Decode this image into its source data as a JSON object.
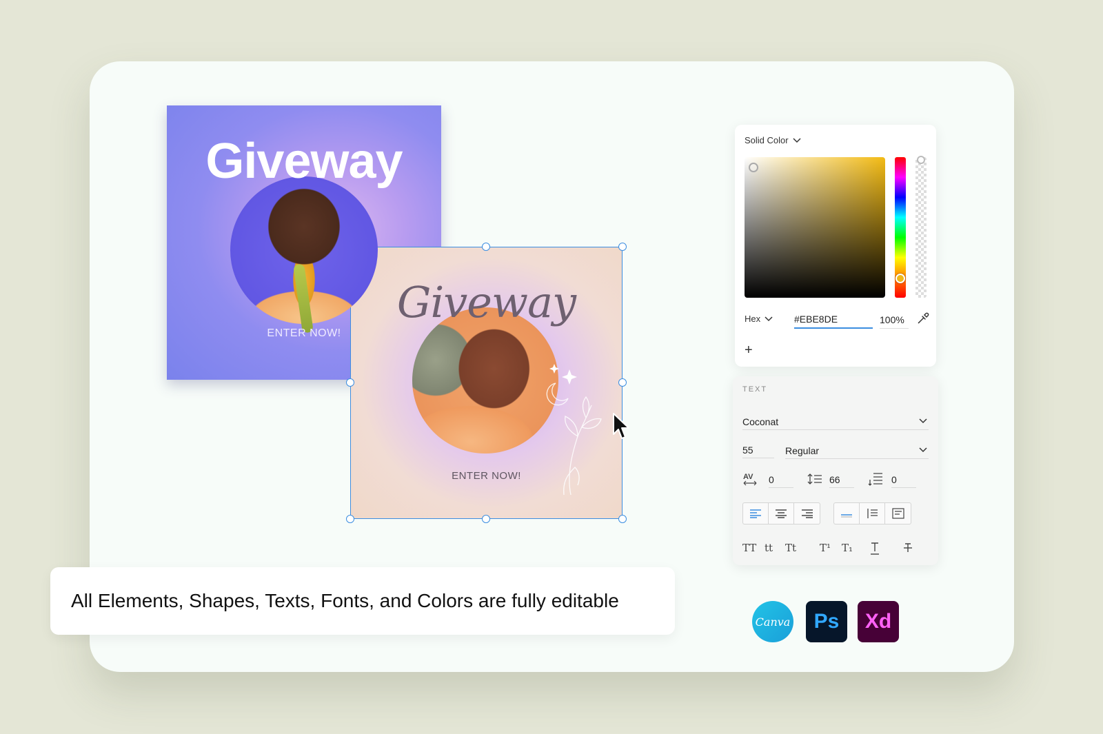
{
  "posters": {
    "first": {
      "title": "Giveway",
      "cta": "ENTER NOW!"
    },
    "second": {
      "title": "Giveway",
      "cta": "ENTER NOW!"
    }
  },
  "color_panel": {
    "mode_label": "Solid Color",
    "format_label": "Hex",
    "hex_value": "#EBE8DE",
    "opacity_value": "100%",
    "add_label": "+",
    "hue_color": "#f3bb14"
  },
  "text_panel": {
    "heading": "TEXT",
    "font_family": "Coconat",
    "font_size": "55",
    "font_weight": "Regular",
    "tracking": "0",
    "line_height": "66",
    "paragraph_spacing": "0",
    "case_options": [
      "TT",
      "tt",
      "Tt",
      "T¹",
      "T₁"
    ]
  },
  "caption": {
    "text": "All Elements, Shapes, Texts, Fonts, and Colors are fully editable"
  },
  "apps": {
    "canva": "Canva",
    "photoshop": "Ps",
    "xd": "Xd"
  },
  "colors": {
    "selection": "#3b8de0",
    "background": "#e4e6d6",
    "card": "#f7fcf9"
  }
}
